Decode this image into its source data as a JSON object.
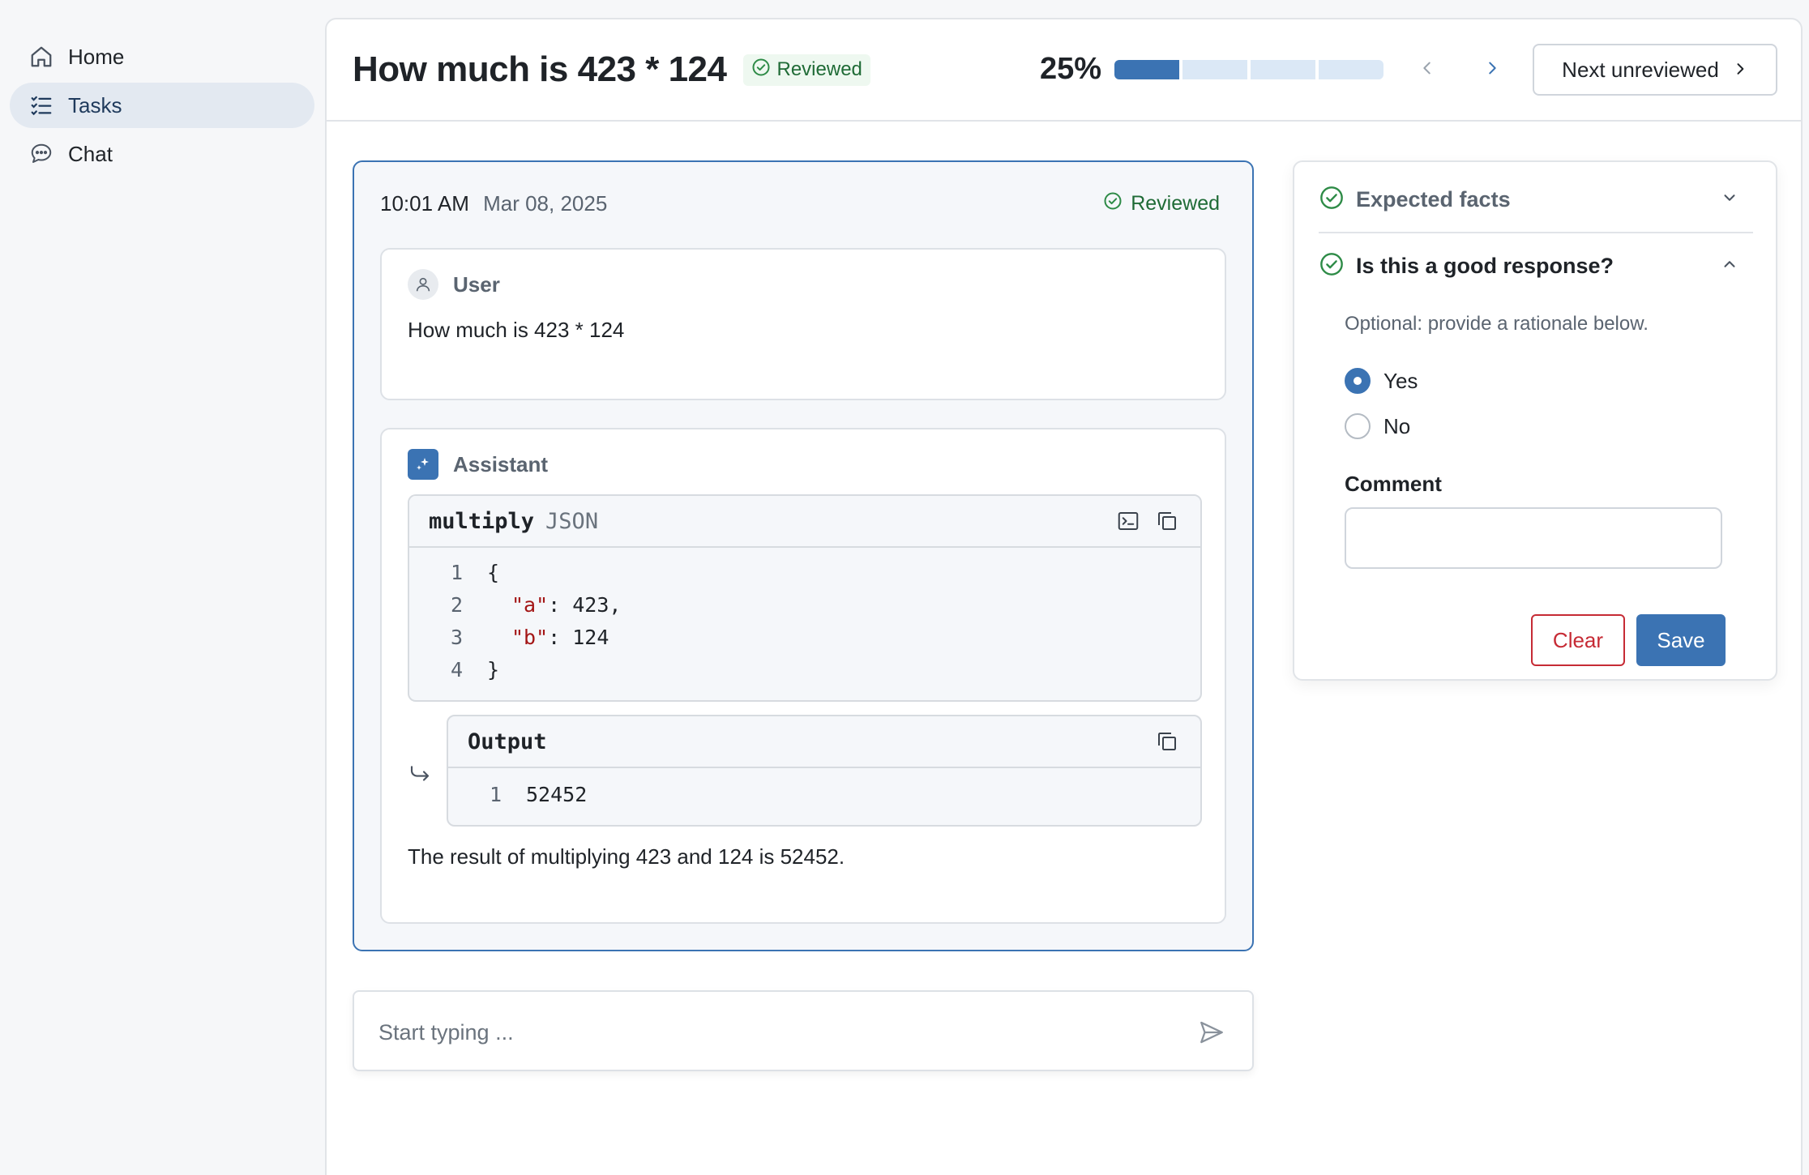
{
  "sidebar": {
    "items": [
      {
        "label": "Home",
        "icon": "home-icon",
        "active": false
      },
      {
        "label": "Tasks",
        "icon": "tasks-icon",
        "active": true
      },
      {
        "label": "Chat",
        "icon": "chat-icon",
        "active": false
      }
    ]
  },
  "header": {
    "title": "How much is 423 * 124",
    "status_badge": "Reviewed",
    "progress_label": "25%",
    "progress_fraction": 0.25,
    "progress_segments": 4,
    "next_unreviewed_label": "Next unreviewed"
  },
  "conversation": {
    "time": "10:01 AM",
    "date": "Mar 08, 2025",
    "status_badge": "Reviewed",
    "user": {
      "role": "User",
      "text": "How much is 423 * 124"
    },
    "assistant": {
      "role": "Assistant",
      "tool_call": {
        "name": "multiply",
        "format": "JSON",
        "lines": [
          {
            "num": "1",
            "text": "{"
          },
          {
            "num": "2",
            "key": "\"a\"",
            "value": ": 423,"
          },
          {
            "num": "3",
            "key": "\"b\"",
            "value": ": 124"
          },
          {
            "num": "4",
            "text": "}"
          }
        ]
      },
      "output": {
        "label": "Output",
        "lines": [
          {
            "num": "1",
            "text": "52452"
          }
        ]
      },
      "text": "The result of multiplying 423 and 124 is 52452."
    }
  },
  "chat_input": {
    "placeholder": "Start typing ..."
  },
  "review": {
    "expected_facts_title": "Expected facts",
    "question_title": "Is this a good response?",
    "hint": "Optional: provide a rationale below.",
    "options": [
      {
        "label": "Yes",
        "selected": true
      },
      {
        "label": "No",
        "selected": false
      }
    ],
    "comment_label": "Comment",
    "comment_value": "",
    "clear_label": "Clear",
    "save_label": "Save"
  },
  "colors": {
    "accent": "#3b73b3",
    "success": "#2e8b47",
    "danger": "#c62b35",
    "code_key": "#a31515"
  }
}
